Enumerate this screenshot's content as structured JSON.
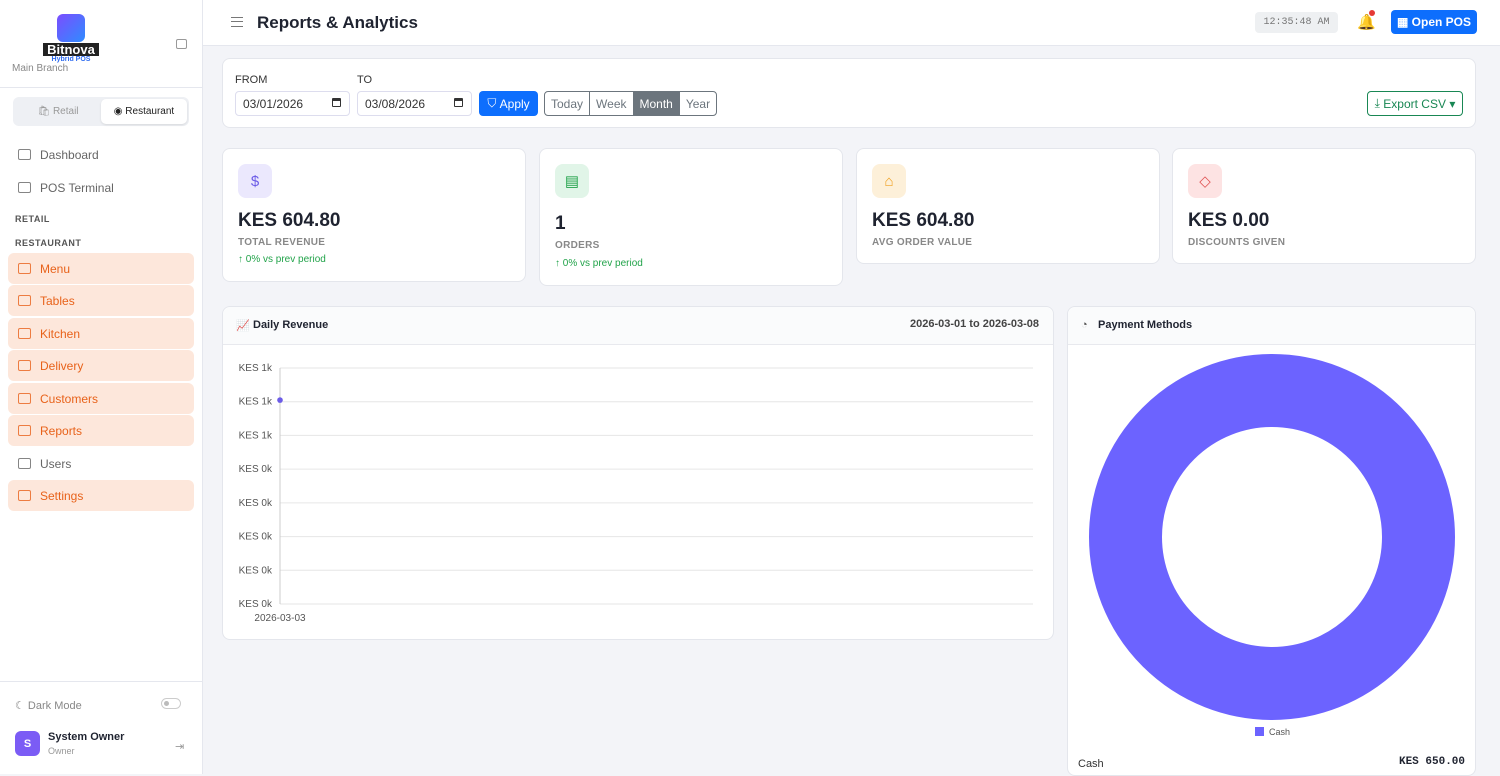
{
  "brand": {
    "name": "Bitnova",
    "subtitle": "Hybrid POS",
    "branch": "Main Branch"
  },
  "mode": {
    "retail": "Retail",
    "restaurant": "Restaurant",
    "active": "Restaurant"
  },
  "nav": {
    "top": [
      {
        "label": "Dashboard"
      },
      {
        "label": "POS Terminal"
      }
    ],
    "section_retail": "RETAIL",
    "section_restaurant": "RESTAURANT",
    "restaurant": [
      {
        "label": "Menu"
      },
      {
        "label": "Tables"
      },
      {
        "label": "Kitchen"
      },
      {
        "label": "Delivery"
      },
      {
        "label": "Customers"
      },
      {
        "label": "Reports"
      },
      {
        "label": "Users"
      },
      {
        "label": "Settings"
      }
    ]
  },
  "footer": {
    "dark_mode": "Dark Mode",
    "avatar_letter": "S",
    "user_name": "System Owner",
    "user_role": "Owner"
  },
  "header": {
    "title": "Reports & Analytics",
    "clock": "12:35:48 AM",
    "open_pos": "Open POS"
  },
  "filters": {
    "from_label": "FROM",
    "to_label": "TO",
    "from": "03/01/2026",
    "to": "03/08/2026",
    "apply": "Apply",
    "periods": [
      "Today",
      "Week",
      "Month",
      "Year"
    ],
    "active_period": "Month",
    "export": "Export CSV"
  },
  "kpis": [
    {
      "value": "KES 604.80",
      "label": "TOTAL REVENUE",
      "delta": "↑ 0% vs prev period",
      "icon": "$",
      "color": "#6c5ce7"
    },
    {
      "value": "1",
      "label": "ORDERS",
      "delta": "↑ 0% vs prev period",
      "icon": "▤",
      "color": "#22a34a"
    },
    {
      "value": "KES 604.80",
      "label": "AVG ORDER VALUE",
      "icon": "⌂",
      "color": "#f0a020"
    },
    {
      "value": "KES 0.00",
      "label": "DISCOUNTS GIVEN",
      "icon": "◇",
      "color": "#e05555"
    }
  ],
  "daily": {
    "title": "Daily Revenue",
    "range": "2026-03-01 to 2026-03-08"
  },
  "payments": {
    "title": "Payment Methods",
    "rows": [
      {
        "method": "Cash",
        "amount": "KES 650.00"
      }
    ]
  },
  "chart_data": [
    {
      "type": "line",
      "title": "Daily Revenue",
      "x": [
        "2026-03-03"
      ],
      "values": [
        604.8
      ],
      "ylim": [
        0,
        700
      ],
      "yticks": [
        {
          "v": 700,
          "label": "KES 1k"
        },
        {
          "v": 600,
          "label": "KES 1k"
        },
        {
          "v": 500,
          "label": "KES 1k"
        },
        {
          "v": 400,
          "label": "KES 0k"
        },
        {
          "v": 300,
          "label": "KES 0k"
        },
        {
          "v": 200,
          "label": "KES 0k"
        },
        {
          "v": 100,
          "label": "KES 0k"
        },
        {
          "v": 0,
          "label": "KES 0k"
        }
      ],
      "color": "#6c5ce7",
      "grid": true
    },
    {
      "type": "pie",
      "title": "Payment Methods",
      "donut": true,
      "categories": [
        "Cash"
      ],
      "values": [
        650
      ],
      "colors": [
        "#6c63ff"
      ],
      "legend": "bottom"
    }
  ]
}
